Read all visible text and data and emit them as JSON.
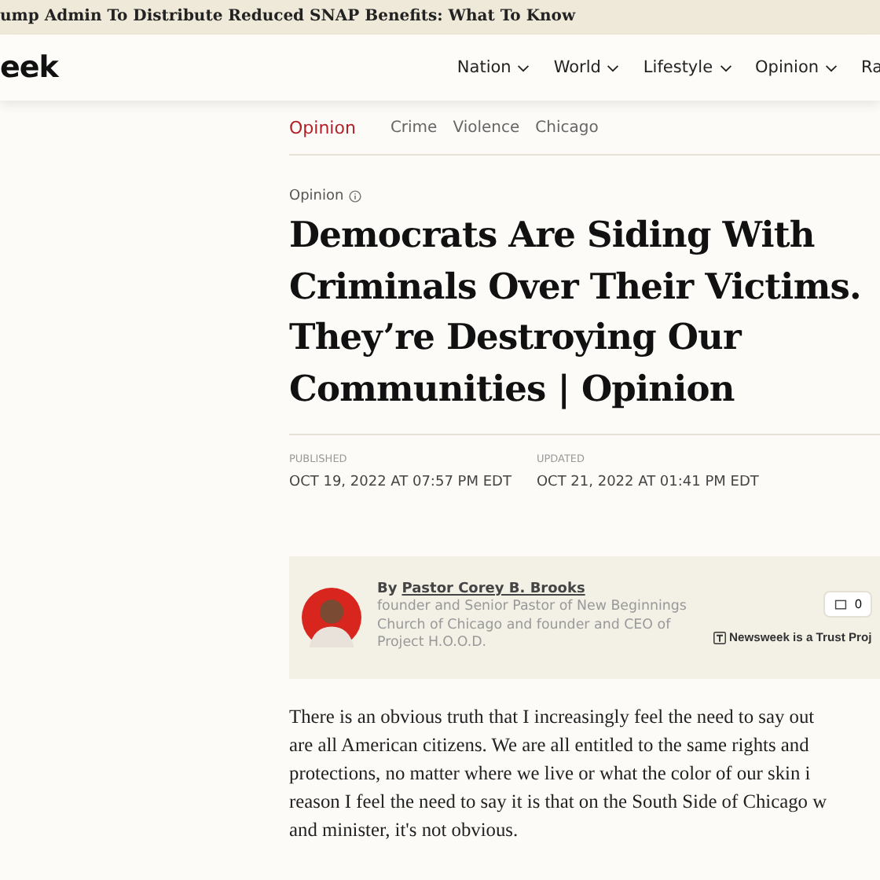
{
  "banner": {
    "text": "ump Admin To Distribute Reduced SNAP Benefits: What To Know"
  },
  "header": {
    "logo": "eek",
    "nav": [
      {
        "label": "Nation",
        "dropdown": true
      },
      {
        "label": "World",
        "dropdown": true
      },
      {
        "label": "Lifestyle",
        "dropdown": true
      },
      {
        "label": "Opinion",
        "dropdown": true
      },
      {
        "label": "Ra",
        "dropdown": false
      }
    ]
  },
  "tags": [
    {
      "label": "Opinion",
      "selected": true
    },
    {
      "label": "Crime",
      "selected": false
    },
    {
      "label": "Violence",
      "selected": false
    },
    {
      "label": "Chicago",
      "selected": false
    }
  ],
  "article": {
    "section": "Opinion",
    "headline": "Democrats Are Siding With Criminals Over Their Victims. They’re Destroying Our Communities | Opinion",
    "published_label": "PUBLISHED",
    "published": "OCT 19, 2022 AT 07:57 PM EDT",
    "updated_label": "UPDATED",
    "updated": "OCT 21, 2022 AT 01:41 PM EDT"
  },
  "author": {
    "by": "By",
    "name": "Pastor Corey B. Brooks",
    "bio": "founder and Senior Pastor of New Beginnings Church of Chicago and founder and CEO of Project H.O.O.D.",
    "comments": "0",
    "trust": "Newsweek is a Trust Proj"
  },
  "body_lines": [
    "There is an obvious truth that I increasingly feel the need to say out",
    "are all American citizens. We are all entitled to the same rights and",
    "protections, no matter where we live or what the color of our skin i",
    "reason I feel the need to say it is that on the South Side of Chicago w",
    "and minister, it's not obvious."
  ]
}
